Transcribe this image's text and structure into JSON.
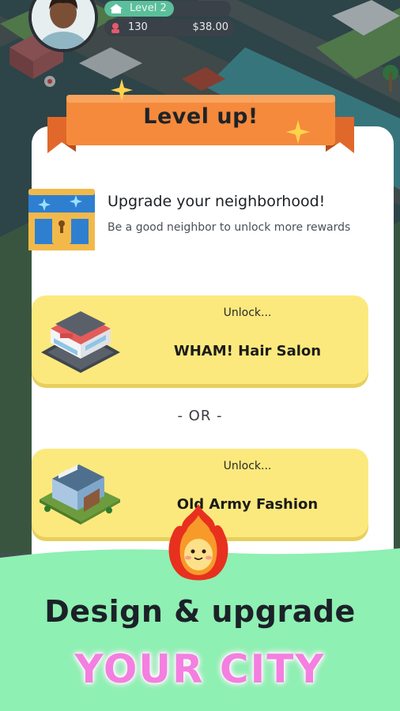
{
  "hud": {
    "level_label": "Level 2",
    "level_progress": 0.55,
    "population": "130",
    "money": "$38.00"
  },
  "dialog": {
    "title": "Level up!",
    "heading": "Upgrade your neighborhood!",
    "subtext": "Be a good neighbor to unlock more rewards",
    "options": [
      {
        "label": "Unlock...",
        "name": "WHAM! Hair Salon"
      },
      {
        "label": "Unlock...",
        "name": "Old Army Fashion"
      }
    ],
    "separator": "- OR -"
  },
  "promo": {
    "line1": "Design & upgrade",
    "line2": "YOUR CITY"
  },
  "colors": {
    "ribbon": "#f58a3c",
    "unlock_card": "#fce97d",
    "promo_green": "#8ef0b2",
    "promo_pink": "#f47fe0"
  }
}
